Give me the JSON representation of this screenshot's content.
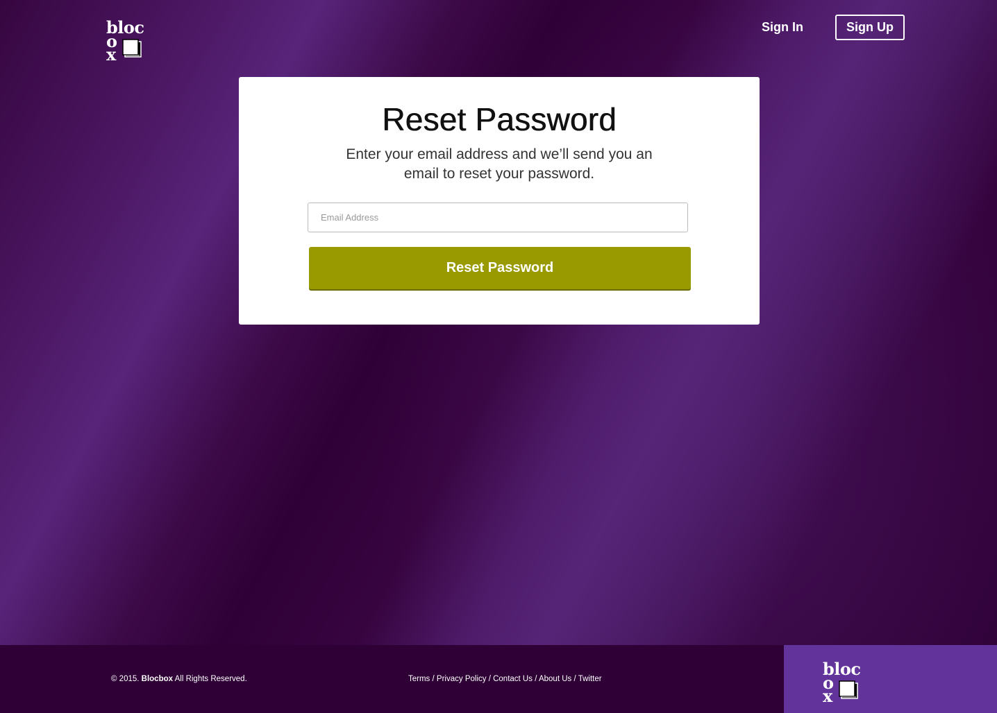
{
  "brand": {
    "logo_line1": "bloc",
    "logo_line2": "o",
    "logo_line3": "x"
  },
  "nav": {
    "sign_in": "Sign In",
    "sign_up": "Sign Up"
  },
  "reset": {
    "title": "Reset Password",
    "description": "Enter your email address and we’ll send you an email to reset your password.",
    "email_placeholder": "Email Address",
    "email_value": "",
    "submit_label": "Reset Password"
  },
  "footer": {
    "copyright_prefix": "© 2015.",
    "copyright_brand": "Blocbox",
    "copyright_suffix": "All Rights Reserved.",
    "links": [
      "Terms",
      "Privacy Policy",
      "Contact Us",
      "About Us",
      "Twitter"
    ],
    "separator": "/"
  },
  "colors": {
    "background": "#2e0036",
    "accent_purple": "#62339a",
    "button_olive": "#999900",
    "card": "#ffffff"
  }
}
